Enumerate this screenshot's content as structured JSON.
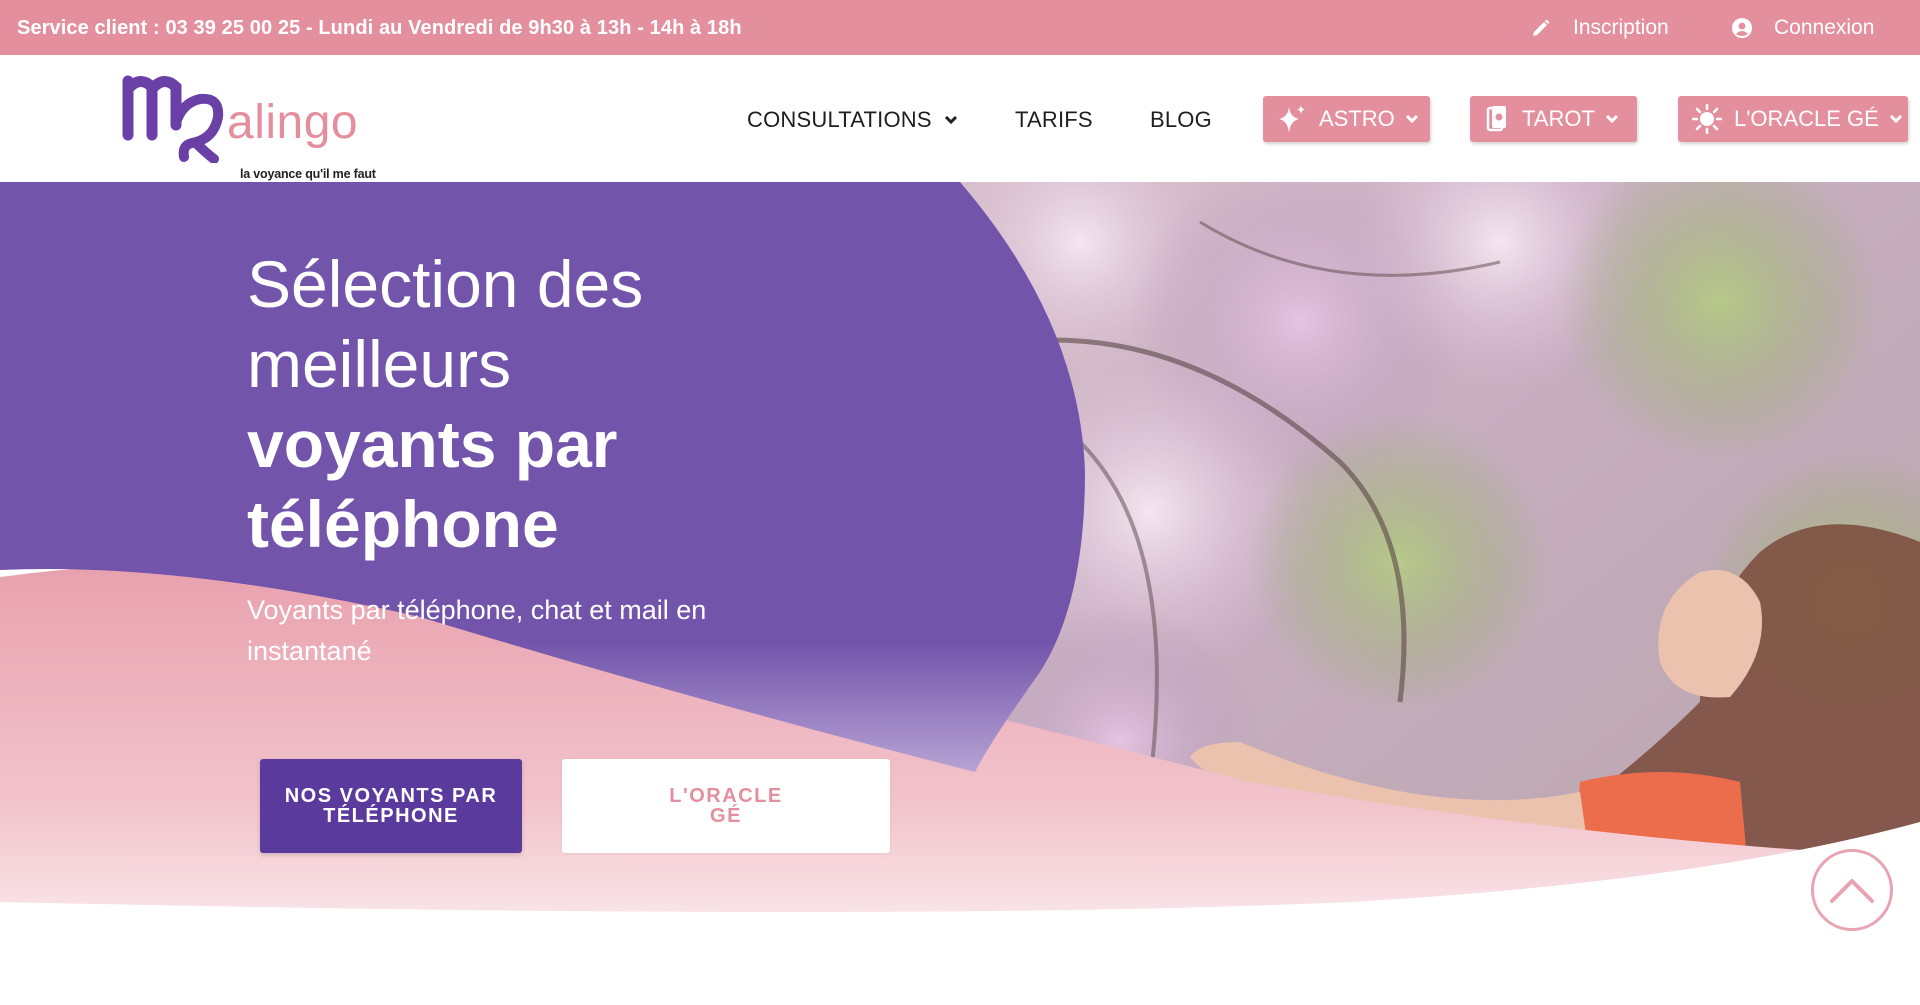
{
  "topbar": {
    "service_text": "Service client : 03 39 25 00 25 - Lundi au Vendredi de 9h30 à 13h - 14h à 18h",
    "inscription_label": "Inscription",
    "connexion_label": "Connexion",
    "icons": {
      "inscription": "pencil-icon",
      "connexion": "user-circle-icon"
    }
  },
  "logo": {
    "word": "alingo",
    "tagline": "la voyance qu'il me faut"
  },
  "nav": {
    "consultations": "CONSULTATIONS",
    "tarifs": "TARIFS",
    "blog": "BLOG",
    "astro": "ASTRO",
    "tarot": "TAROT",
    "oracle": "L'ORACLE GÉ"
  },
  "hero": {
    "title_line1": "Sélection des",
    "title_line2": "meilleurs",
    "title_line3": "voyants par",
    "title_line4": "téléphone",
    "subtitle": "Voyants par téléphone, chat et mail en instantané",
    "cta_voyants_line1": "NOS VOYANTS PAR",
    "cta_voyants_line2": "TÉLÉPHONE",
    "cta_oracle_line1": "L'ORACLE",
    "cta_oracle_line2": "GÉ"
  },
  "colors": {
    "pink": "#e48f9d",
    "purple": "#7254ab",
    "dark_purple": "#5b3a9e",
    "white": "#ffffff"
  }
}
